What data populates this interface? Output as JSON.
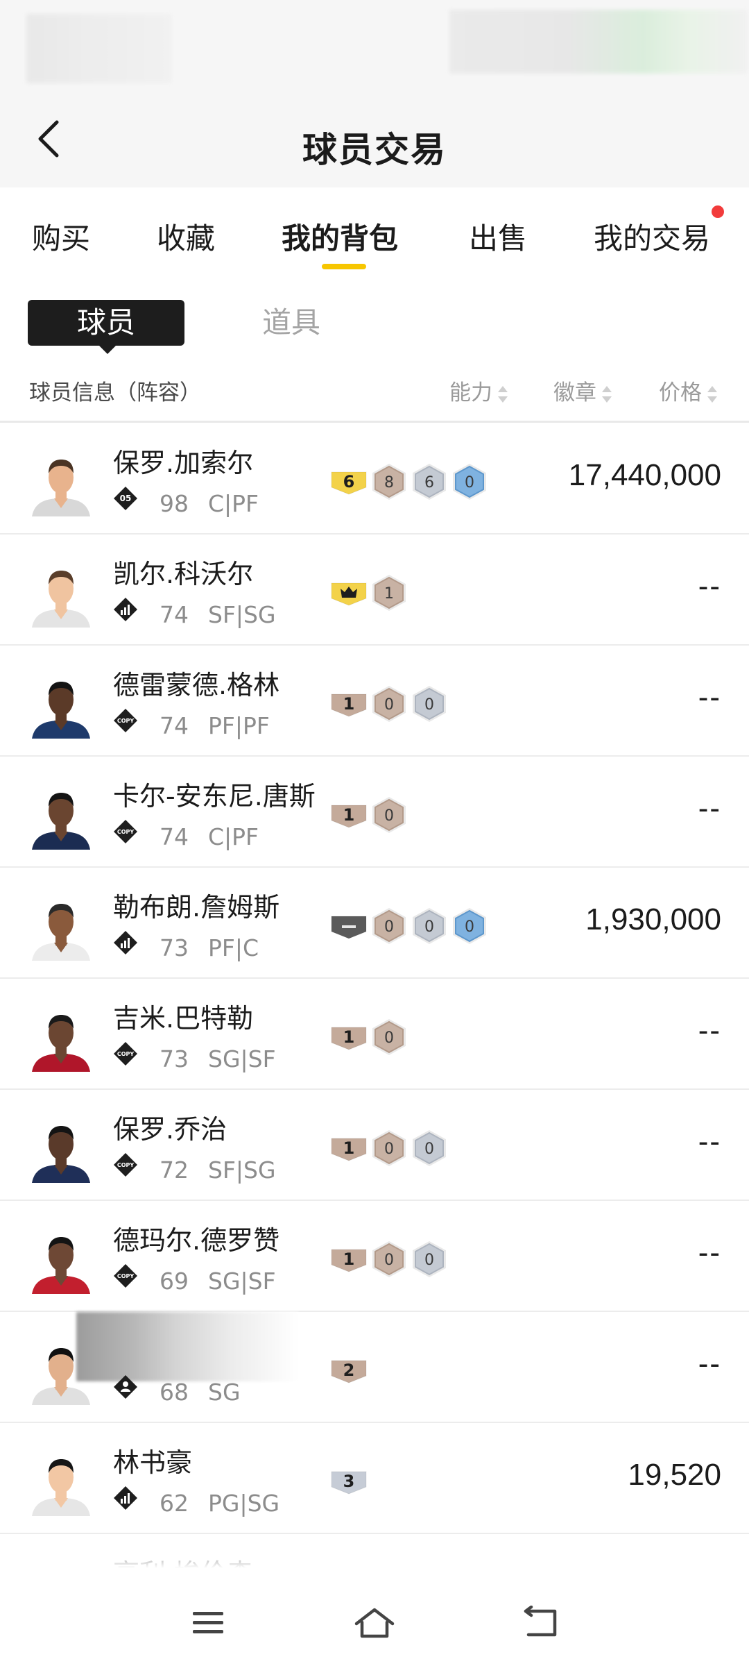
{
  "header": {
    "title": "球员交易"
  },
  "tabs": [
    {
      "label": "购买"
    },
    {
      "label": "收藏"
    },
    {
      "label": "我的背包"
    },
    {
      "label": "出售"
    },
    {
      "label": "我的交易"
    }
  ],
  "subtabs": {
    "player": "球员",
    "item": "道具"
  },
  "columns": {
    "info": "球员信息（阵容）",
    "ability": "能力",
    "badge": "徽章",
    "price": "价格"
  },
  "colors": {
    "accent": "#f7c600",
    "notification": "#f23b3b"
  },
  "rows": [
    {
      "name": "保罗.加索尔",
      "type_icon": "season-05-icon",
      "type_text": "05",
      "rating": "98",
      "pos": "C|PF",
      "badges": [
        {
          "kind": "gold-tag",
          "text": "6"
        },
        {
          "kind": "bronze",
          "text": "8"
        },
        {
          "kind": "silver",
          "text": "6"
        },
        {
          "kind": "blue",
          "text": "0"
        }
      ],
      "price": "17,440,000"
    },
    {
      "name": "凯尔.科沃尔",
      "type_icon": "stats-icon",
      "rating": "74",
      "pos": "SF|SG",
      "badges": [
        {
          "kind": "crown-tag",
          "text": ""
        },
        {
          "kind": "bronze",
          "text": "1"
        }
      ],
      "price": "--"
    },
    {
      "name": "德雷蒙德.格林",
      "type_icon": "copy-icon",
      "type_text": "COPY",
      "rating": "74",
      "pos": "PF|PF",
      "badges": [
        {
          "kind": "bronze-tag",
          "text": "1"
        },
        {
          "kind": "bronze",
          "text": "0"
        },
        {
          "kind": "silver",
          "text": "0"
        }
      ],
      "price": "--"
    },
    {
      "name": "卡尔-安东尼.唐斯",
      "type_icon": "copy-icon",
      "type_text": "COPY",
      "rating": "74",
      "pos": "C|PF",
      "badges": [
        {
          "kind": "bronze-tag",
          "text": "1"
        },
        {
          "kind": "bronze",
          "text": "0"
        }
      ],
      "price": "--"
    },
    {
      "name": "勒布朗.詹姆斯",
      "type_icon": "stats-icon",
      "rating": "73",
      "pos": "PF|C",
      "badges": [
        {
          "kind": "dark-tag",
          "text": ""
        },
        {
          "kind": "bronze",
          "text": "0"
        },
        {
          "kind": "silver",
          "text": "0"
        },
        {
          "kind": "blue",
          "text": "0"
        }
      ],
      "price": "1,930,000"
    },
    {
      "name": "吉米.巴特勒",
      "type_icon": "copy-icon",
      "type_text": "COPY",
      "rating": "73",
      "pos": "SG|SF",
      "badges": [
        {
          "kind": "bronze-tag",
          "text": "1"
        },
        {
          "kind": "bronze",
          "text": "0"
        }
      ],
      "price": "--"
    },
    {
      "name": "保罗.乔治",
      "type_icon": "copy-icon",
      "type_text": "COPY",
      "rating": "72",
      "pos": "SF|SG",
      "badges": [
        {
          "kind": "bronze-tag",
          "text": "1"
        },
        {
          "kind": "bronze",
          "text": "0"
        },
        {
          "kind": "silver",
          "text": "0"
        }
      ],
      "price": "--"
    },
    {
      "name": "德玛尔.德罗赞",
      "type_icon": "copy-icon",
      "type_text": "COPY",
      "rating": "69",
      "pos": "SG|SF",
      "badges": [
        {
          "kind": "bronze-tag",
          "text": "1"
        },
        {
          "kind": "bronze",
          "text": "0"
        },
        {
          "kind": "silver",
          "text": "0"
        }
      ],
      "price": "--"
    },
    {
      "name": "",
      "type_icon": "person-icon",
      "rating": "68",
      "pos": "SG",
      "badges": [
        {
          "kind": "bronze-tag",
          "text": "2"
        }
      ],
      "price": "--"
    },
    {
      "name": "林书豪",
      "type_icon": "stats-icon",
      "rating": "62",
      "pos": "PG|SG",
      "badges": [
        {
          "kind": "silver-tag",
          "text": "3"
        }
      ],
      "price": "19,520"
    },
    {
      "name": "亨利.埃伦森",
      "type_icon": "",
      "rating": "",
      "pos": "",
      "badges": [],
      "price": ""
    }
  ],
  "nav": {
    "menu": "menu-icon",
    "home": "home-icon",
    "back": "back-icon"
  }
}
